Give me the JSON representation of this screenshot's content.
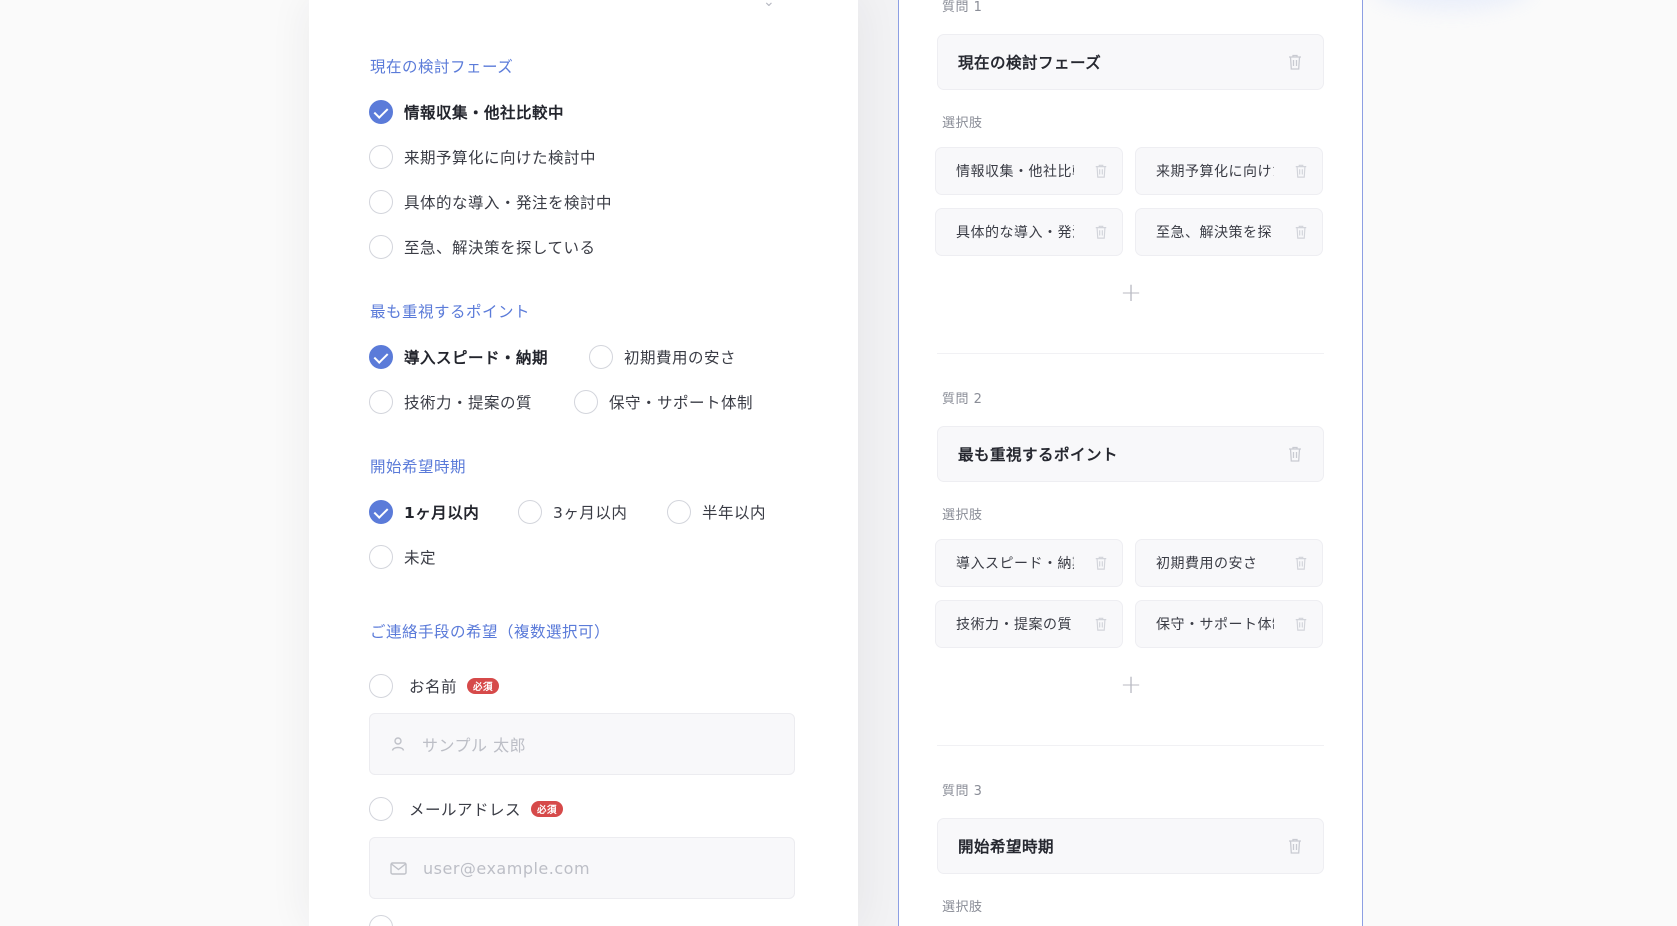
{
  "preview": {
    "questions": [
      {
        "title": "現在の検討フェーズ",
        "options": [
          {
            "label": "情報収集・他社比較中",
            "checked": true
          },
          {
            "label": "来期予算化に向けた検討中",
            "checked": false
          },
          {
            "label": "具体的な導入・発注を検討中",
            "checked": false
          },
          {
            "label": "至急、解決策を探している",
            "checked": false
          }
        ]
      },
      {
        "title": "最も重視するポイント",
        "options": [
          {
            "label": "導入スピード・納期",
            "checked": true
          },
          {
            "label": "初期費用の安さ",
            "checked": false
          },
          {
            "label": "技術力・提案の質",
            "checked": false
          },
          {
            "label": "保守・サポート体制",
            "checked": false
          }
        ]
      },
      {
        "title": "開始希望時期",
        "options": [
          {
            "label": "1ヶ月以内",
            "checked": true
          },
          {
            "label": "3ヶ月以内",
            "checked": false
          },
          {
            "label": "半年以内",
            "checked": false
          },
          {
            "label": "未定",
            "checked": false
          }
        ]
      }
    ],
    "contact": {
      "title": "ご連絡手段の希望（複数選択可）",
      "required_label": "必須",
      "name": {
        "label": "お名前",
        "placeholder": "サンプル 太郎",
        "icon": "user-icon"
      },
      "email": {
        "label": "メールアドレス",
        "placeholder": "user@example.com",
        "icon": "mail-icon"
      }
    }
  },
  "editor": {
    "options_label": "選択肢",
    "questions": [
      {
        "label": "質問 1",
        "text": "現在の検討フェーズ",
        "options": [
          "情報収集・他社比較中",
          "来期予算化に向けた検討中",
          "具体的な導入・発注を検討中",
          "至急、解決策を探している"
        ]
      },
      {
        "label": "質問 2",
        "text": "最も重視するポイント",
        "options": [
          "導入スピード・納期",
          "初期費用の安さ",
          "技術力・提案の質",
          "保守・サポート体制"
        ]
      },
      {
        "label": "質問 3",
        "text": "開始希望時期"
      }
    ]
  },
  "colors": {
    "accent": "#5b7bd9",
    "required": "#d64a4a",
    "editor_border": "#8d9fe3"
  }
}
